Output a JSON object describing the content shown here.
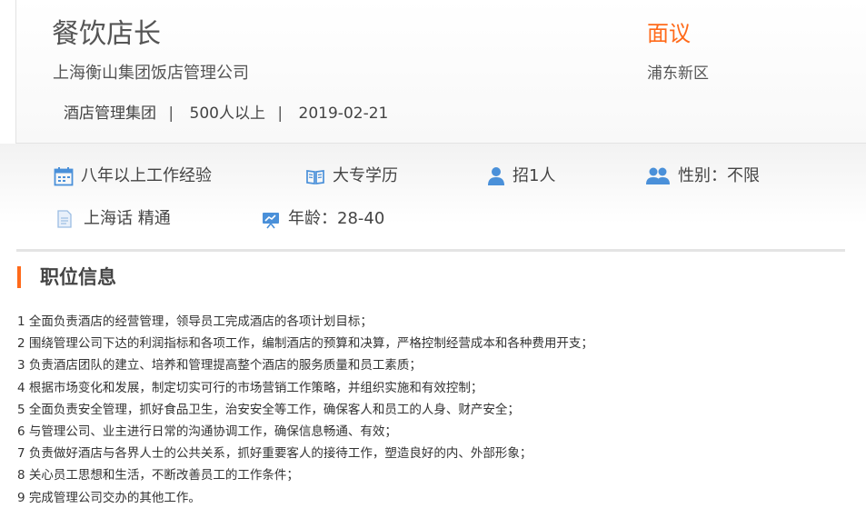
{
  "job": {
    "title": "餐饮店长",
    "salary": "面议",
    "company": "上海衡山集团饭店管理公司",
    "location": "浦东新区",
    "meta": {
      "company_type": "酒店管理集团",
      "sep1": "|",
      "size": "500人以上",
      "sep2": "|",
      "date": "2019-02-21"
    }
  },
  "requirements": {
    "experience": "八年以上工作经验",
    "education": "大专学历",
    "headcount": "招1人",
    "gender": "性别：不限",
    "language": "上海话 精通",
    "age": "年龄：28-40"
  },
  "section": {
    "title": "职位信息"
  },
  "duties": [
    "1 全面负责酒店的经营管理，领导员工完成酒店的各项计划目标；",
    "2 围绕管理公司下达的利润指标和各项工作，编制酒店的预算和决算，严格控制经营成本和各种费用开支；",
    "3 负责酒店团队的建立、培养和管理提高整个酒店的服务质量和员工素质；",
    "4 根据市场变化和发展，制定切实可行的市场营销工作策略，并组织实施和有效控制；",
    "5 全面负责安全管理，抓好食品卫生，治安安全等工作，确保客人和员工的人身、财产安全；",
    "6 与管理公司、业主进行日常的沟通协调工作，确保信息畅通、有效；",
    "7 负责做好酒店与各界人士的公共关系，抓好重要客人的接待工作，塑造良好的内、外部形象；",
    "8 关心员工思想和生活，不断改善员工的工作条件；",
    "9 完成管理公司交办的其他工作。"
  ],
  "colors": {
    "accent": "#ff6a1a",
    "icon": "#4a90d9"
  }
}
